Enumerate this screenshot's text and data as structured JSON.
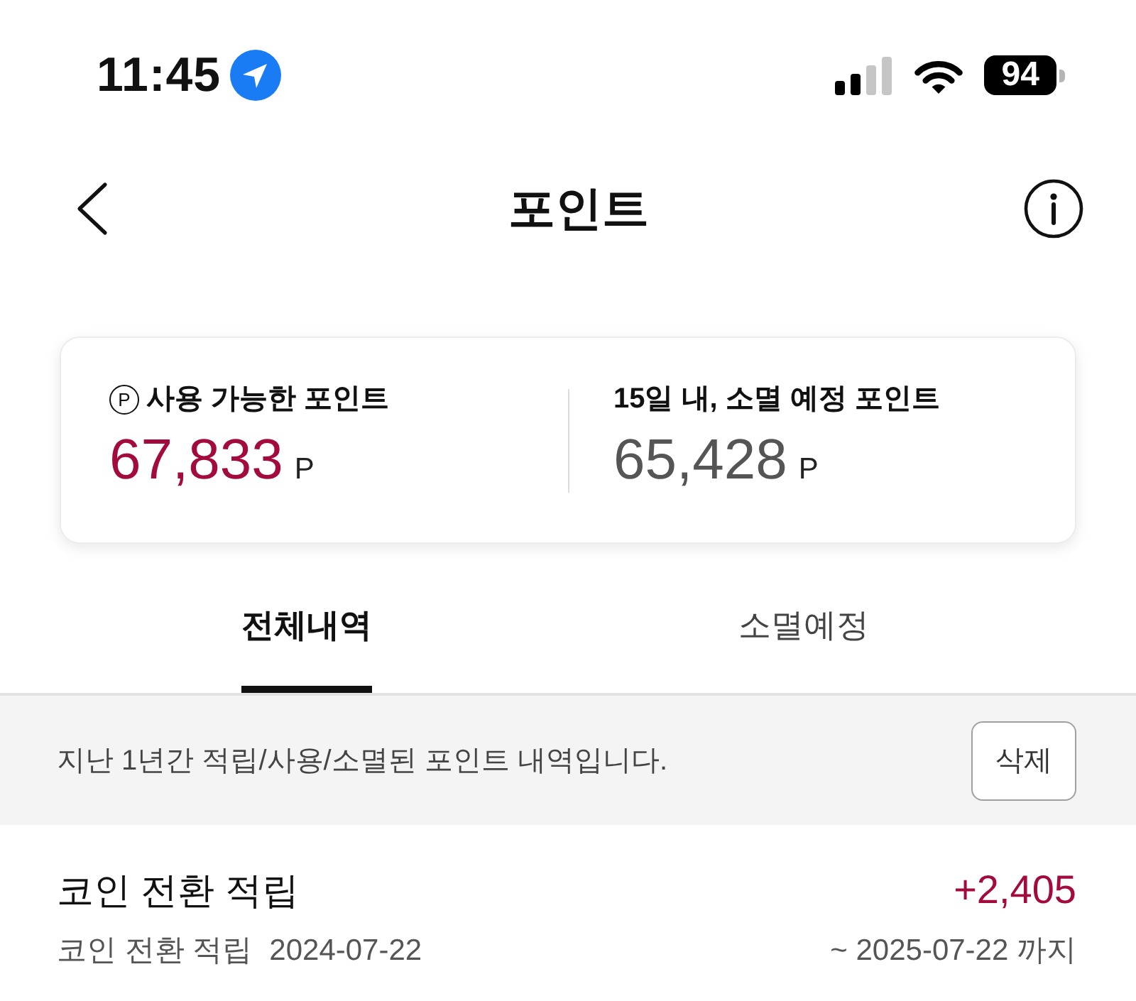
{
  "status_bar": {
    "time": "11:45",
    "battery": "94"
  },
  "header": {
    "title": "포인트"
  },
  "summary": [
    {
      "kind": "available",
      "symbol": "P",
      "label": "사용 가능한 포인트",
      "value": "67,833",
      "unit": "P"
    },
    {
      "kind": "expiring",
      "label": "15일 내, 소멸 예정 포인트",
      "value": "65,428",
      "unit": "P"
    }
  ],
  "tabs": [
    {
      "label": "전체내역",
      "selected": true
    },
    {
      "label": "소멸예정",
      "selected": false
    }
  ],
  "notice": {
    "text": "지난 1년간 적립/사용/소멸된 포인트 내역입니다.",
    "button": "삭제"
  },
  "history": [
    {
      "title": "코인 전환 적립",
      "amount": "+2,405",
      "description": "코인 전환 적립",
      "date": "2024-07-22",
      "expiry": "~ 2025-07-22 까지"
    }
  ]
}
